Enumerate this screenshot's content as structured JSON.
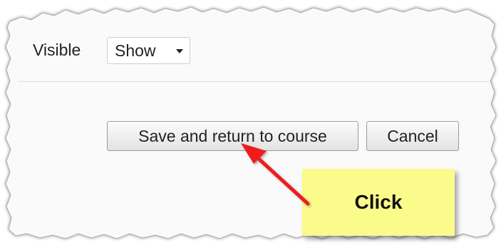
{
  "form": {
    "visible_label": "Visible",
    "visible_select_value": "Show"
  },
  "actions": {
    "save_label": "Save and return to course",
    "cancel_label": "Cancel"
  },
  "annotation": {
    "callout_text": "Click",
    "callout_color": "#fbfb8c",
    "arrow_color": "#ee1c1c"
  }
}
